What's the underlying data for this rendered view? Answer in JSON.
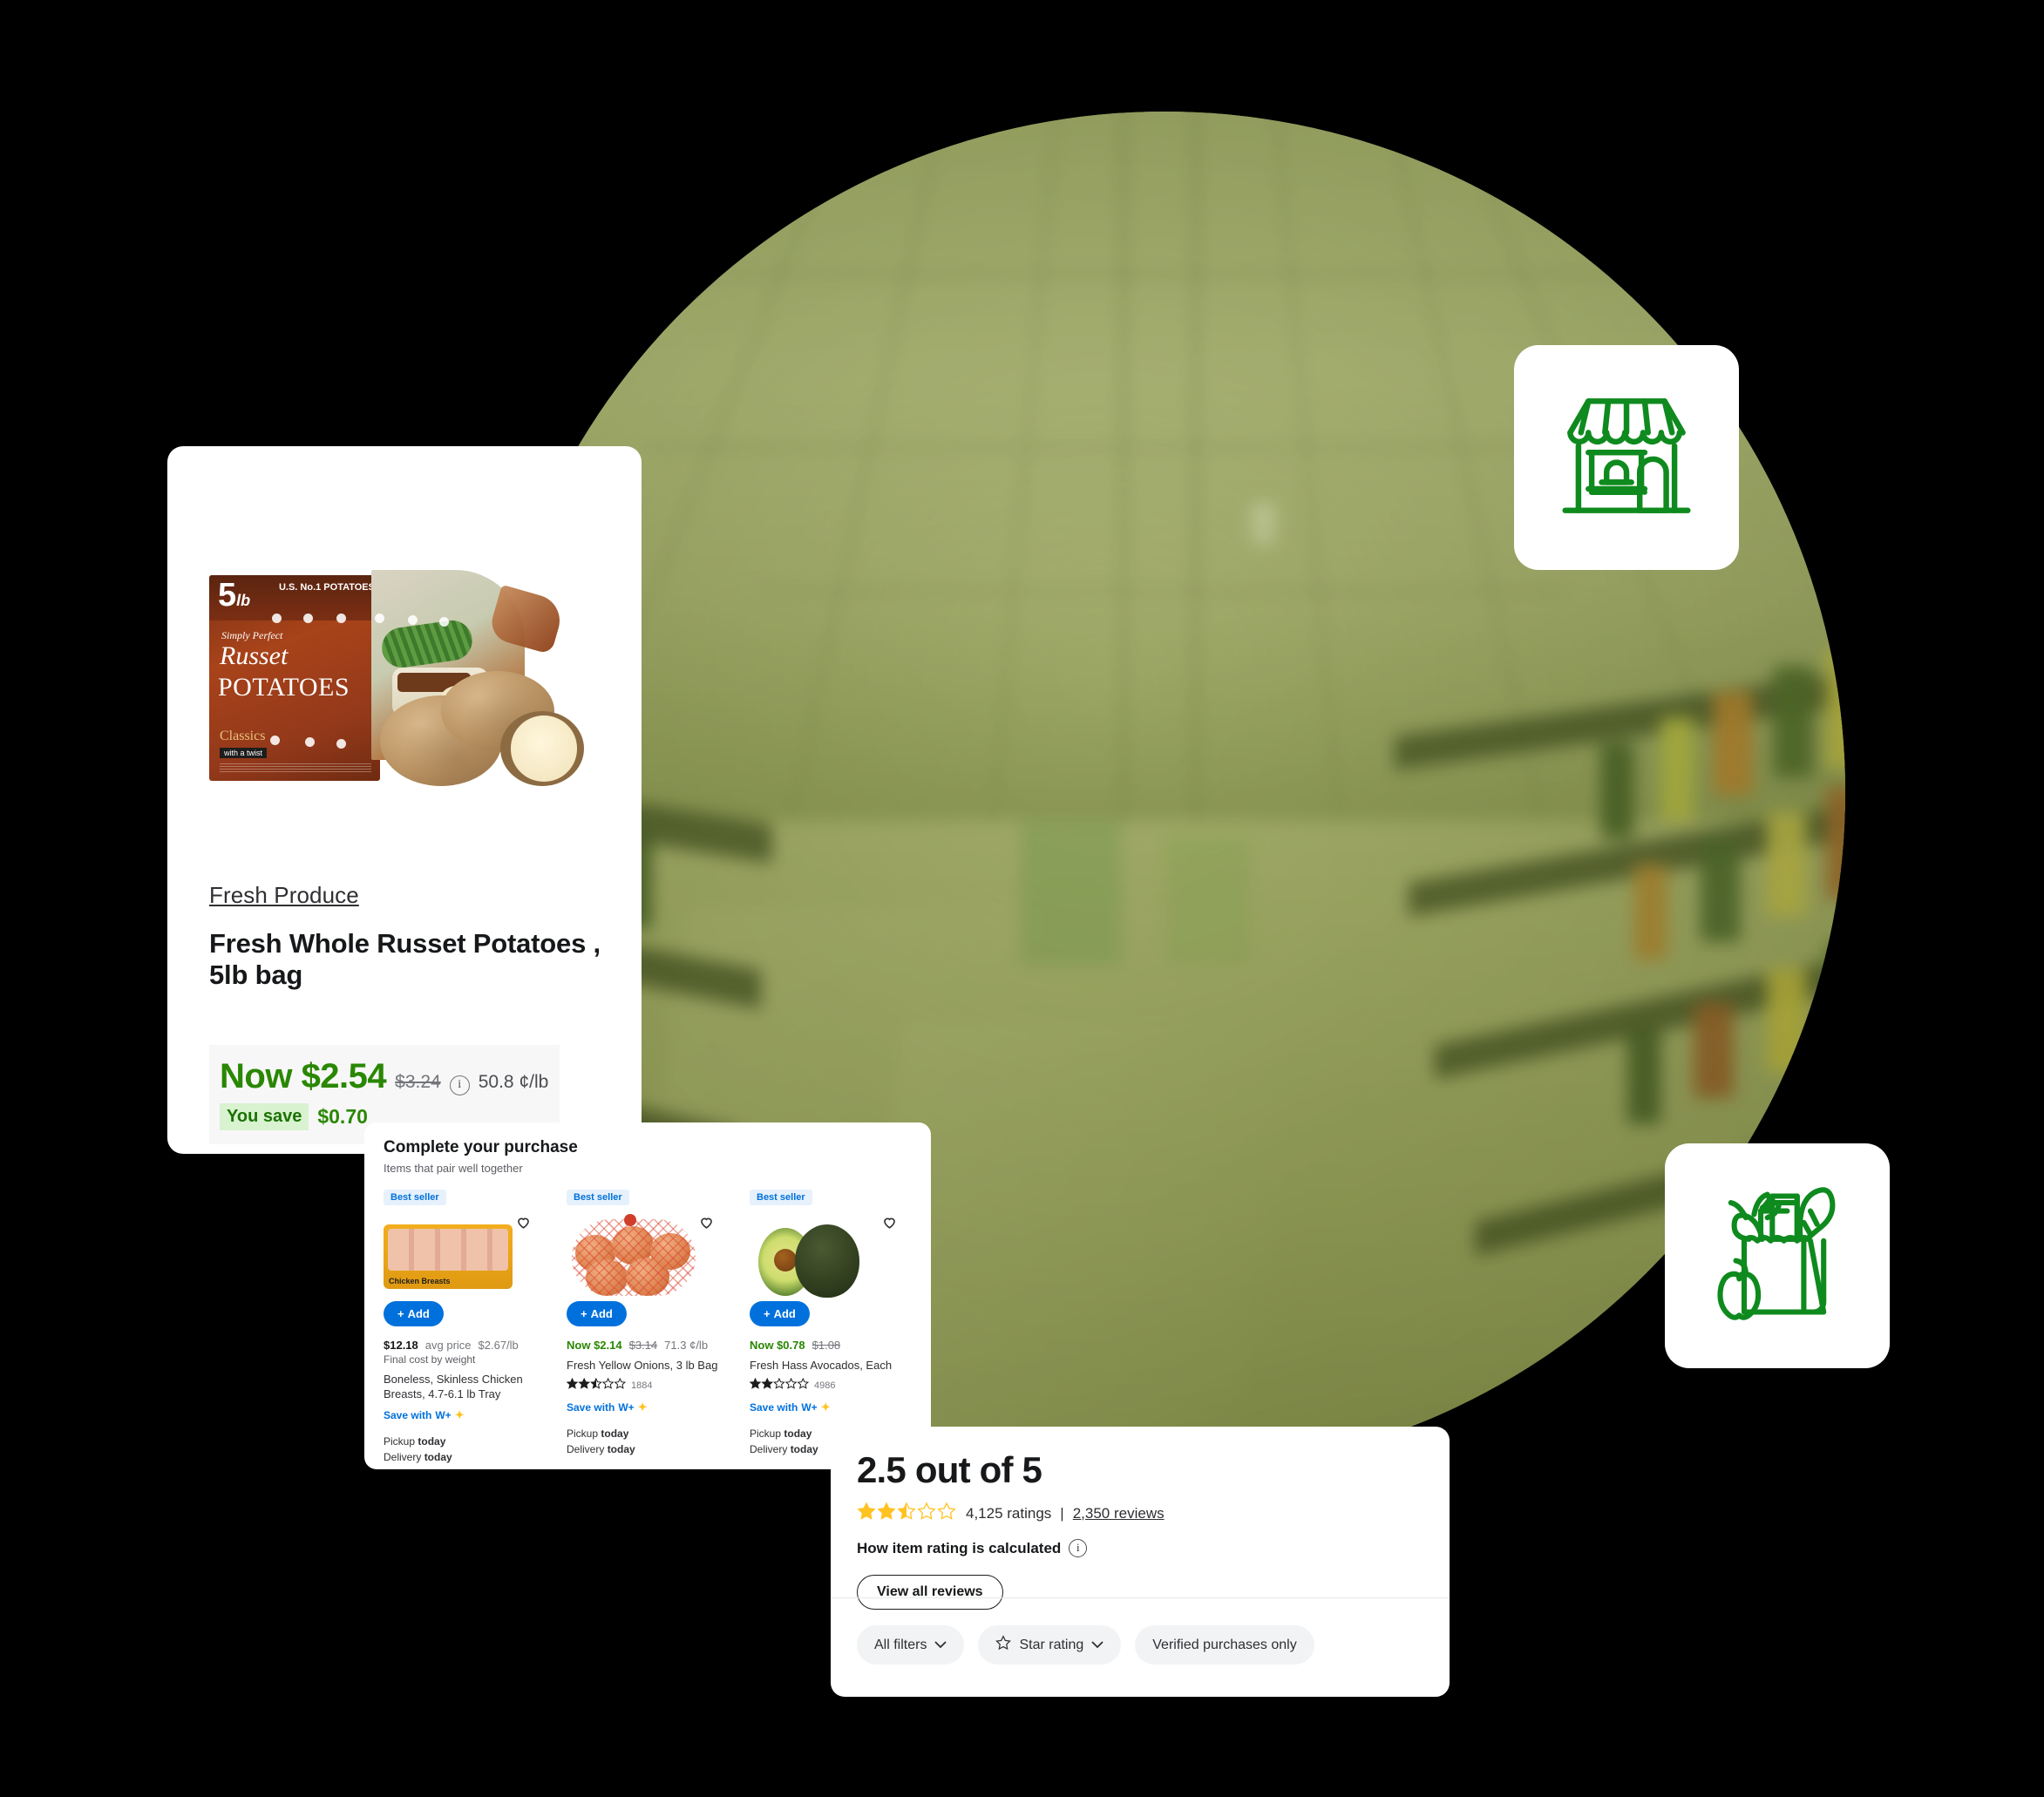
{
  "theme": {
    "brand_green": "#2a8703",
    "icon_green": "#0f8a1e",
    "link_blue": "#0071dc",
    "star_gold": "#ffc220",
    "circle_green": "#8d9a4e"
  },
  "product_card": {
    "breadcrumb": "Fresh Produce",
    "title": "Fresh Whole Russet Potatoes , 5lb bag",
    "now_label": "Now",
    "now_price": "$2.54",
    "was_price": "$3.24",
    "info_icon": "info-icon",
    "unit_price": "50.8 ¢/lb",
    "you_save_label": "You save",
    "you_save_amount": "$0.70",
    "image": {
      "name": "russet-potatoes-5lb-bag",
      "bag_weight": "5",
      "bag_weight_unit": "lb",
      "bag_no1": "U.S. No.1 POTATOES",
      "bag_simply": "Simply Perfect",
      "bag_russet": "Russet",
      "bag_potatoes": "POTATOES",
      "bag_classics": "Classics",
      "bag_twist": "with a twist"
    }
  },
  "purchase_card": {
    "title": "Complete your purchase",
    "subtitle": "Items that pair well together",
    "badge_label": "Best seller",
    "add_label": "Add",
    "add_plus": "+",
    "save_with_label": "Save with",
    "wplus_label": "W+",
    "pickup_label": "Pickup",
    "pickup_value": "today",
    "delivery_label": "Delivery",
    "delivery_value": "today",
    "items": [
      {
        "name": "Boneless, Skinless Chicken Breasts, 4.7-6.1 lb Tray",
        "badge": "Best seller",
        "price": "$12.18",
        "price_qualifier": "avg price",
        "unit_price": "$2.67/lb",
        "final_cost_note": "Final cost by weight",
        "now_label": "",
        "was_price": "",
        "rating": null,
        "rating_count": "",
        "image_label": "Chicken Breasts"
      },
      {
        "name": "Fresh Yellow Onions, 3 lb Bag",
        "badge": "Best seller",
        "now_label": "Now",
        "price": "$2.14",
        "was_price": "$3.14",
        "unit_price": "71.3 ¢/lb",
        "price_qualifier": "",
        "final_cost_note": "",
        "rating": 2.5,
        "rating_count": "1884"
      },
      {
        "name": "Fresh Hass Avocados, Each",
        "badge": "Best seller",
        "now_label": "Now",
        "price": "$0.78",
        "was_price": "$1.08",
        "unit_price": "",
        "price_qualifier": "",
        "final_cost_note": "",
        "rating": 2.0,
        "rating_count": "4986"
      }
    ]
  },
  "ratings_card": {
    "score_text": "2.5 out of 5",
    "score_value": 2.5,
    "ratings_count": "4,125 ratings",
    "separator": "|",
    "reviews_link": "2,350 reviews",
    "how_calculated": "How item rating is calculated",
    "how_calculated_icon": "info-icon",
    "view_all_button": "View all reviews",
    "filters": [
      {
        "label": "All filters",
        "icon": "chevron-down-icon",
        "leading_icon": ""
      },
      {
        "label": "Star rating",
        "icon": "chevron-down-icon",
        "leading_icon": "star-outline-icon"
      },
      {
        "label": "Verified purchases only",
        "icon": "",
        "leading_icon": ""
      }
    ]
  },
  "icon_tiles": [
    {
      "name": "storefront-icon",
      "label": "storefront"
    },
    {
      "name": "grocery-bag-icon",
      "label": "grocery bag"
    }
  ]
}
